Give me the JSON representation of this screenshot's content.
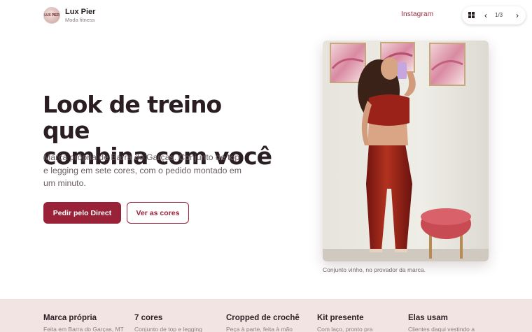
{
  "header": {
    "logo_text": "LUX PIER",
    "brand_name": "Lux Pier",
    "brand_sub": "Moda fitness",
    "instagram_label": "Instagram",
    "pager": {
      "grid_icon": "grid-icon",
      "prev_icon": "chevron-left-icon",
      "next_icon": "chevron-right-icon",
      "count": "1/3"
    }
  },
  "hero": {
    "title_line1": "Look de treino que",
    "title_line2": "combina com você",
    "description": "Marca própria de Barra do Garças. Conjunto de top e legging em sete cores, com o pedido montado em um minuto.",
    "primary_cta": "Pedir pelo Direct",
    "secondary_cta": "Ver as cores"
  },
  "photo": {
    "caption": "Conjunto vinho, no provador da marca."
  },
  "features": [
    {
      "title": "Marca própria",
      "desc": "Feita em Barra do Garças, MT"
    },
    {
      "title": "7 cores",
      "desc": "Conjunto de top e legging"
    },
    {
      "title": "Cropped de crochê",
      "desc": "Peça à parte, feita à mão"
    },
    {
      "title": "Kit presente",
      "desc": "Com laço, pronto pra"
    },
    {
      "title": "Elas usam",
      "desc": "Clientes daqui vestindo a"
    }
  ],
  "colors": {
    "accent": "#9a2238",
    "band_bg": "#f3e4e4",
    "text_dark": "#2a1e22"
  }
}
